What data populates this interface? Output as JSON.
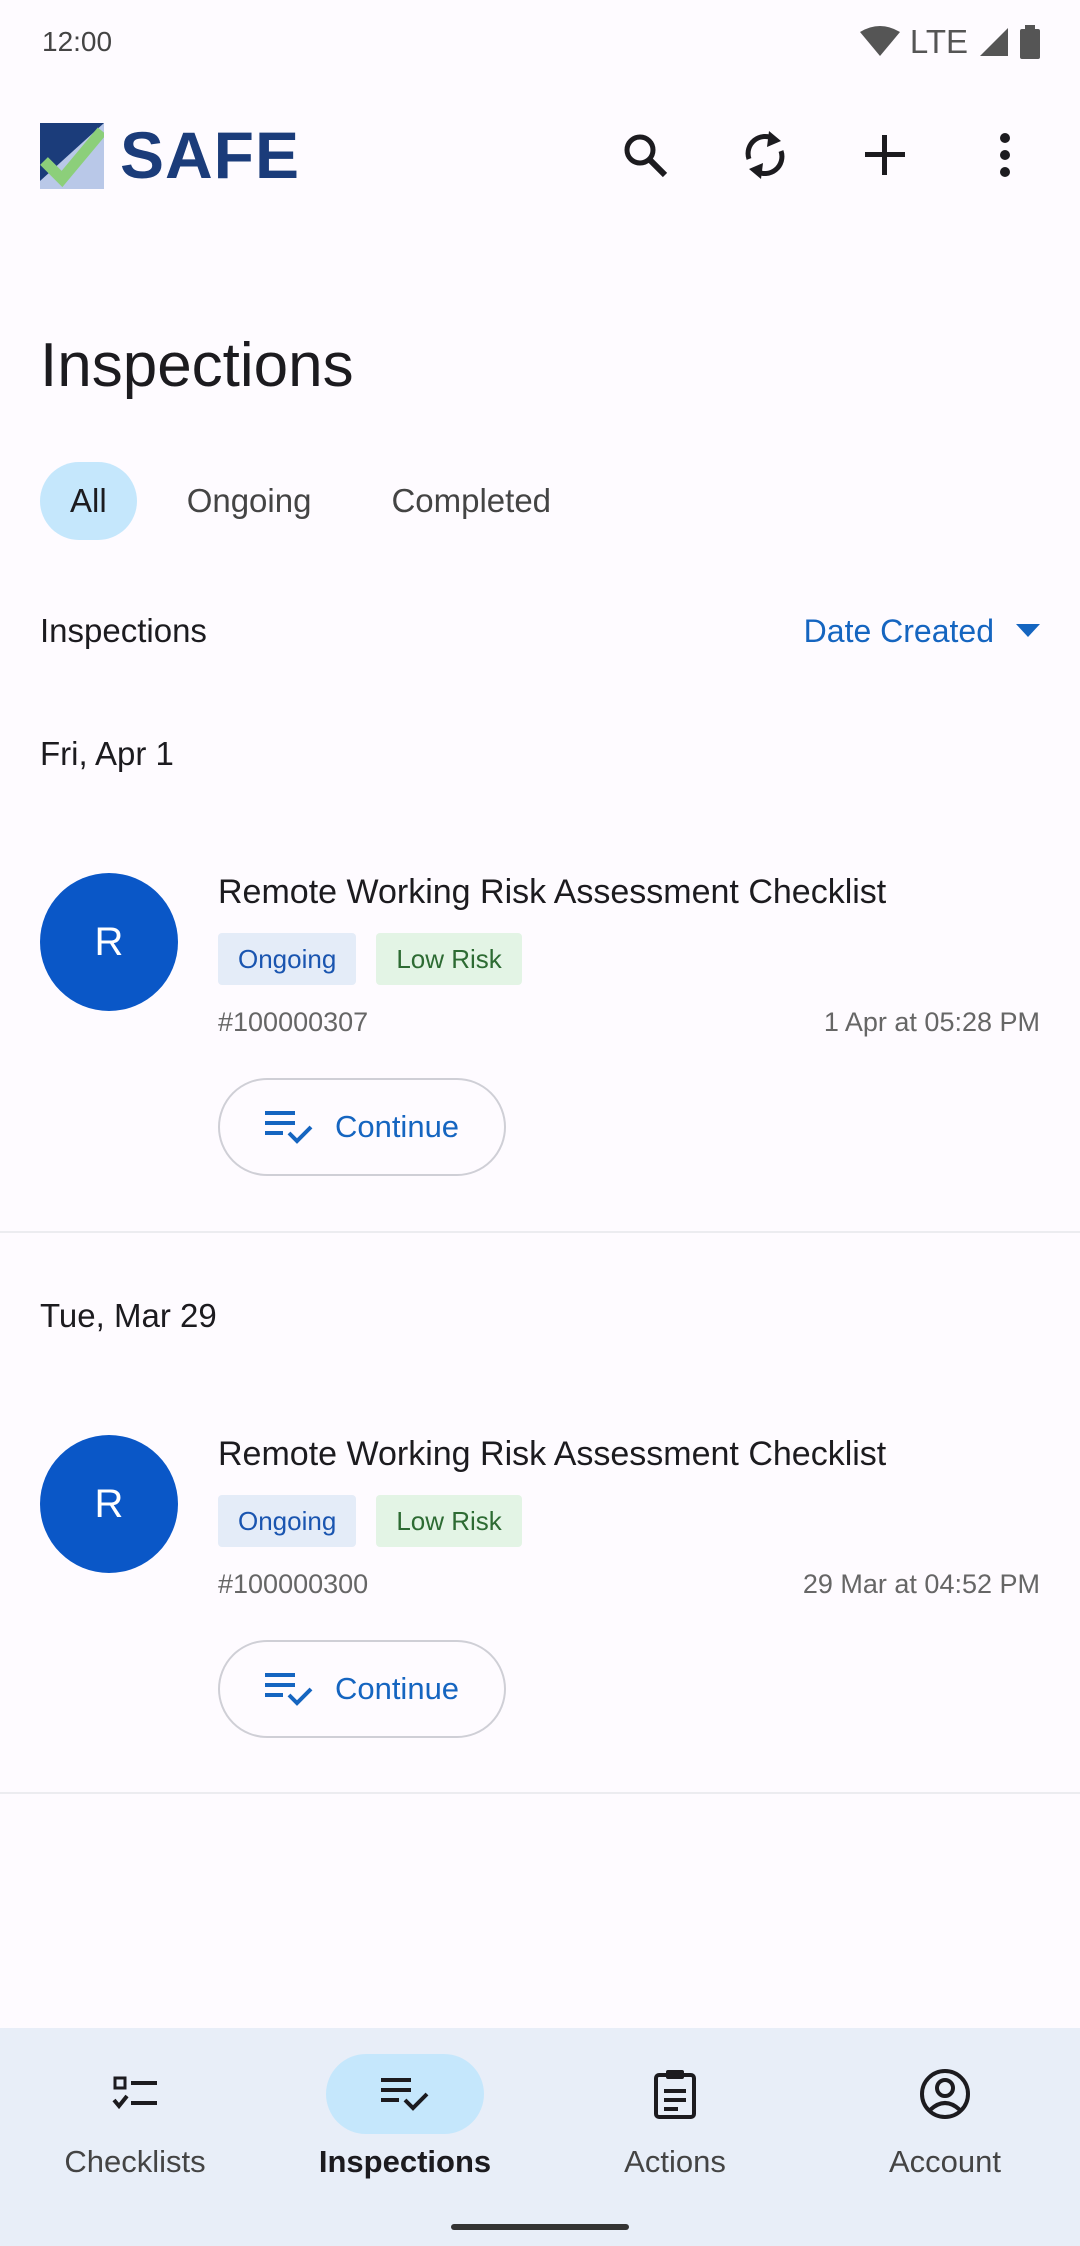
{
  "status_bar": {
    "time": "12:00",
    "network": "LTE"
  },
  "app": {
    "logo_text": "SAFE",
    "brand_color": "#1b3c7a",
    "accent": "#1565c0"
  },
  "actions": {
    "search_icon": "search-icon",
    "sync_icon": "sync-icon",
    "add_icon": "add-icon",
    "more_icon": "more-vert-icon"
  },
  "page": {
    "title": "Inspections"
  },
  "filters": {
    "all": "All",
    "ongoing": "Ongoing",
    "completed": "Completed",
    "selected": "All"
  },
  "list_header": {
    "label": "Inspections",
    "sort_label": "Date Created"
  },
  "groups": [
    {
      "date": "Fri, Apr 1",
      "items": [
        {
          "avatar_letter": "R",
          "title": "Remote Working Risk Assessment Checklist",
          "status": "Ongoing",
          "risk": "Low Risk",
          "id": "#100000307",
          "created": "1 Apr at 05:28 PM",
          "action": "Continue"
        }
      ]
    },
    {
      "date": "Tue, Mar 29",
      "items": [
        {
          "avatar_letter": "R",
          "title": "Remote Working Risk Assessment Checklist",
          "status": "Ongoing",
          "risk": "Low Risk",
          "id": "#100000300",
          "created": "29 Mar at 04:52 PM",
          "action": "Continue"
        }
      ]
    }
  ],
  "bottom_nav": {
    "items": [
      {
        "label": "Checklists",
        "icon": "checklist-icon"
      },
      {
        "label": "Inspections",
        "icon": "inspections-icon"
      },
      {
        "label": "Actions",
        "icon": "clipboard-icon"
      },
      {
        "label": "Account",
        "icon": "account-icon"
      }
    ],
    "active": "Inspections"
  }
}
